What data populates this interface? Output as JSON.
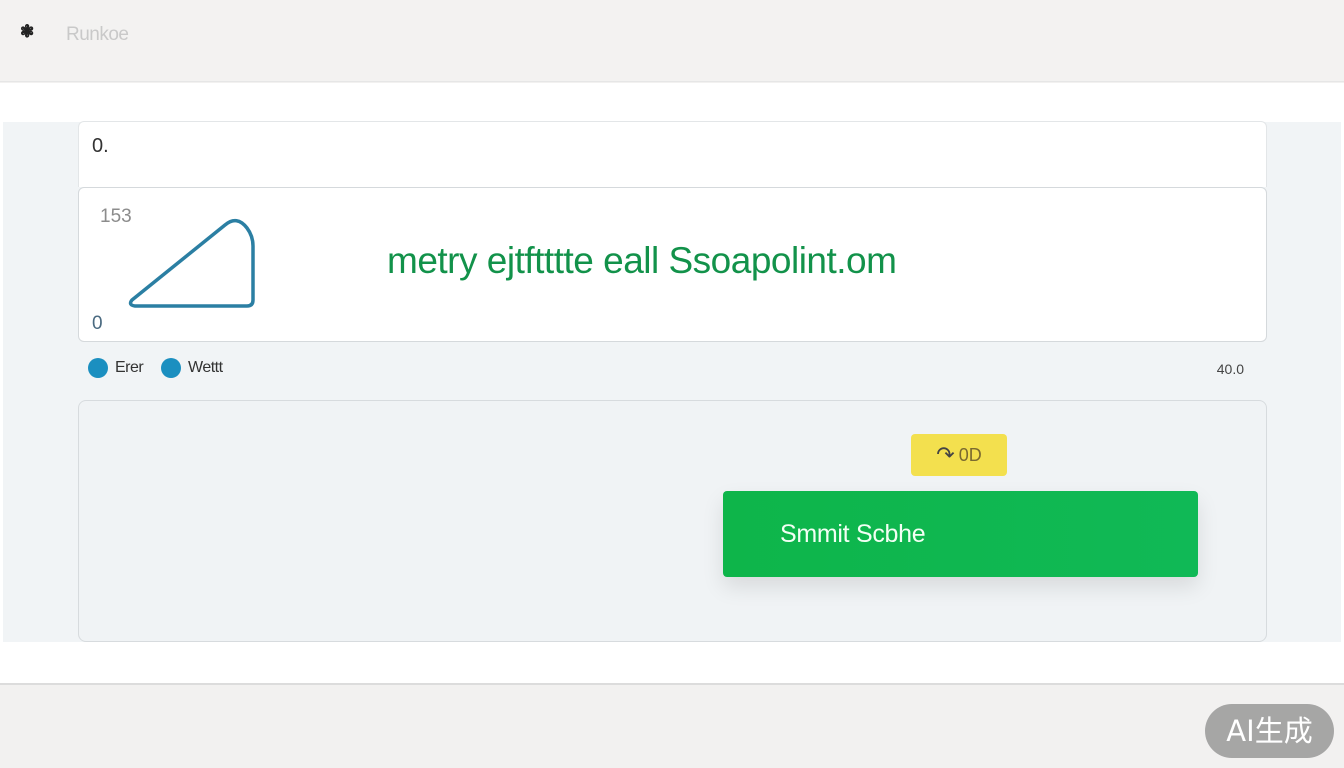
{
  "app": {
    "icon": "app-logo-icon",
    "title": "Runkoe"
  },
  "input": {
    "value": "0."
  },
  "chart_data": {
    "type": "line",
    "y_tick_labels": [
      "153",
      "0"
    ],
    "headline": "metry ejtftttte eall Ssoapolint.om",
    "series_color": "#2b7fa3"
  },
  "legend": {
    "items": [
      {
        "label": "Erer",
        "color": "#1b8fc0"
      },
      {
        "label": "Wettt",
        "color": "#1b8fc0"
      }
    ],
    "right_text": "40.0"
  },
  "action": {
    "badge_icon": "refresh-arrow-icon",
    "badge_text": "0D",
    "badge_color": "#f3e04e",
    "submit_label": "Smmit Scbhe",
    "submit_color": "#0eb54a"
  },
  "watermark": {
    "text": "AI生成"
  }
}
